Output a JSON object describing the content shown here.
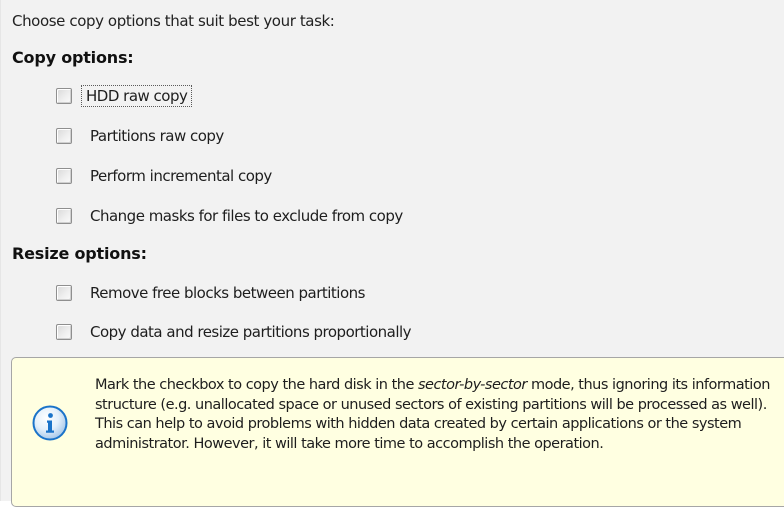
{
  "intro_text": "Choose copy options that suit best your task:",
  "copy_options": {
    "title": "Copy options:",
    "items": [
      {
        "label": "HDD raw copy",
        "checked": false,
        "focused": true
      },
      {
        "label": "Partitions raw copy",
        "checked": false
      },
      {
        "label": "Perform incremental copy",
        "checked": false
      },
      {
        "label": "Change masks for files to exclude from copy",
        "checked": false
      }
    ]
  },
  "resize_options": {
    "title": "Resize options:",
    "items": [
      {
        "label": "Remove free blocks between partitions",
        "checked": false
      },
      {
        "label": "Copy data and resize partitions proportionally",
        "checked": false
      }
    ]
  },
  "info": {
    "icon": "info-icon",
    "text_before": "Mark the checkbox to copy the hard disk in the ",
    "text_emphasis": "sector-by-sector",
    "text_after": " mode, thus ignoring its information structure (e.g. unallocated space or unused sectors of existing partitions will be processed as well). This can help to avoid problems with hidden data created by certain applications or the system administrator. However, it will take more time to accomplish the operation."
  },
  "colors": {
    "info_background": "#ffffe1",
    "info_icon": "#1a73c9"
  }
}
